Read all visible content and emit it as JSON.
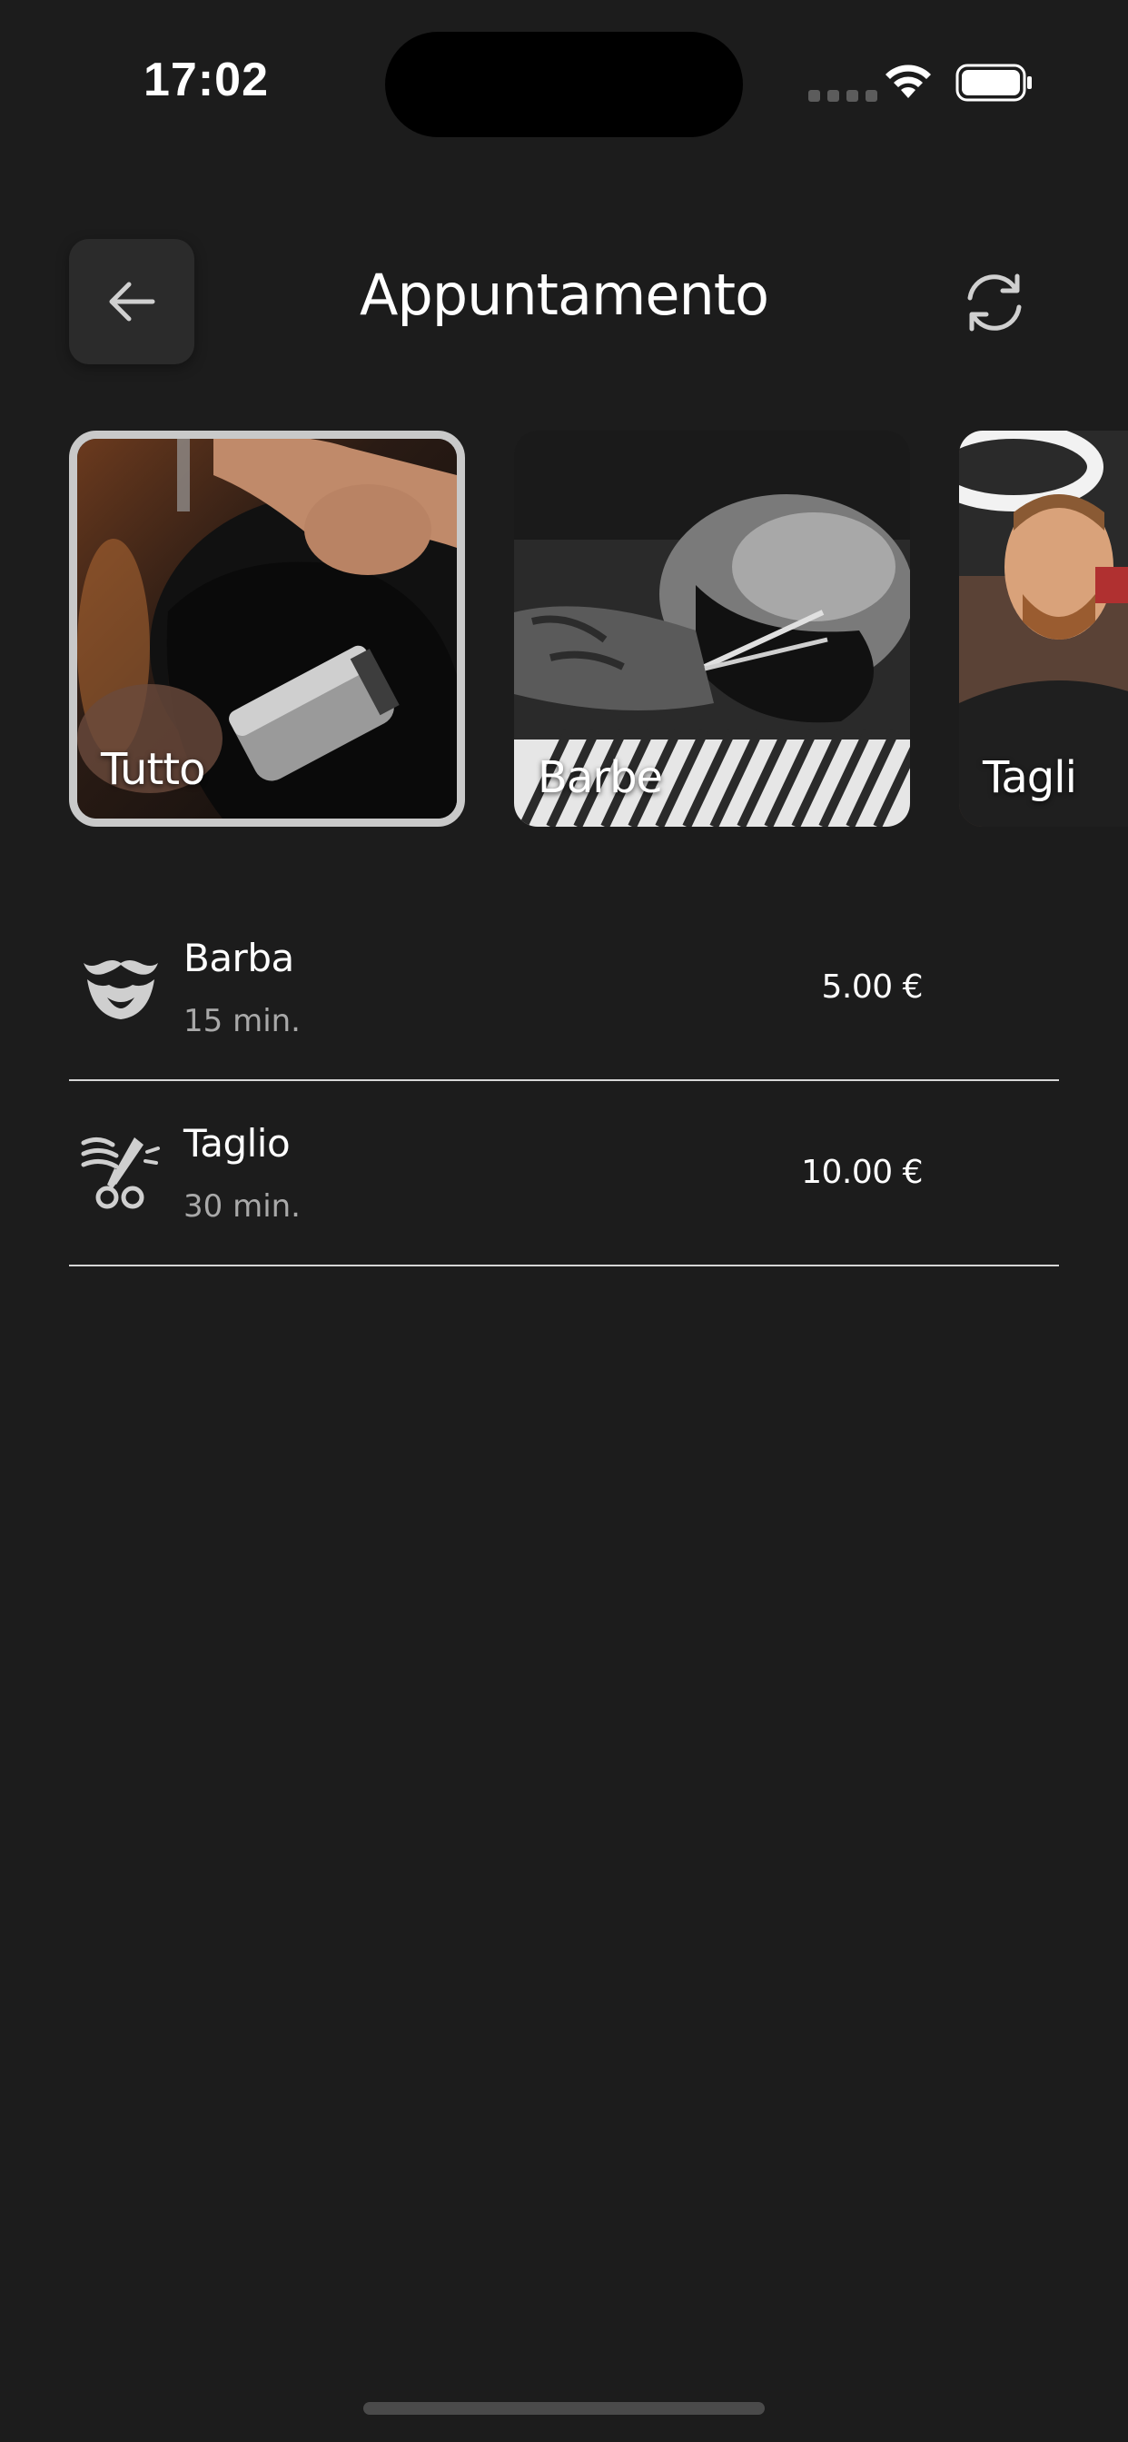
{
  "status_bar": {
    "time": "17:02",
    "wifi_icon": "wifi-icon",
    "battery_icon": "battery-icon"
  },
  "header": {
    "title": "Appuntamento",
    "back_icon": "arrow-left-icon",
    "refresh_icon": "refresh-icon"
  },
  "categories": [
    {
      "label": "Tutto",
      "selected": true
    },
    {
      "label": "Barbe",
      "selected": false
    },
    {
      "label": "Tagli",
      "selected": false
    }
  ],
  "services": [
    {
      "name": "Barba",
      "duration": "15 min.",
      "price": "5.00 €",
      "icon": "mustache-beard-icon"
    },
    {
      "name": "Taglio",
      "duration": "30 min.",
      "price": "10.00 €",
      "icon": "scissors-comb-icon"
    }
  ],
  "colors": {
    "background": "#1c1c1c",
    "card_border_selected": "#c9c9c9",
    "divider": "#d6d6d6",
    "secondary_text": "#a9a9a9"
  }
}
